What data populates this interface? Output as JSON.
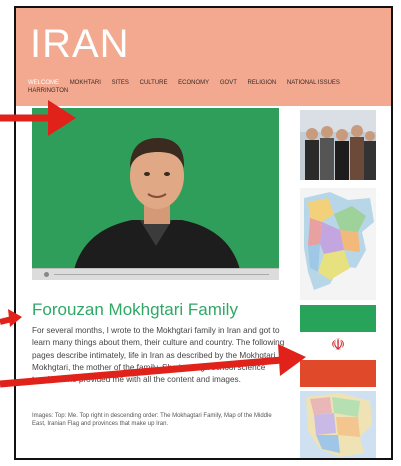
{
  "site": {
    "title": "IRAN",
    "header_color": "#f2a98f",
    "accent_color": "#2fa866",
    "arrow_color": "#e0221b"
  },
  "nav": {
    "items": [
      {
        "label": "WELCOME",
        "active": true
      },
      {
        "label": "MOKHTARI",
        "active": false
      },
      {
        "label": "SITES",
        "active": false
      },
      {
        "label": "CULTURE",
        "active": false
      },
      {
        "label": "ECONOMY",
        "active": false
      },
      {
        "label": "GOVT",
        "active": false
      },
      {
        "label": "RELIGION",
        "active": false
      },
      {
        "label": "NATIONAL ISSUES",
        "active": false
      },
      {
        "label": "HARRINGTON",
        "active": false
      }
    ]
  },
  "main": {
    "heading": "Forouzan Mokhgtari Family",
    "paragraph": "For several months, I wrote to the Mokhgtari family in Iran and got to learn many things about them, their culture and country. The following pages describe intimately, life in Iran as described by the Mokhgtari ... Mokhgtari, the mother of the family. She is a high school science teacher who provided me with all the content and images.",
    "caption": "Images: Top: Me. Top right in descending order: The Mokhagtari Family, Map of the Middle East, Iranian Flag and provinces that make up Iran."
  },
  "sidebar": {
    "images": [
      {
        "name": "family-photo",
        "icon": "people"
      },
      {
        "name": "middle-east-map",
        "icon": "map"
      },
      {
        "name": "iranian-flag",
        "icon": "flag"
      },
      {
        "name": "iran-provinces-map",
        "icon": "map"
      }
    ]
  }
}
